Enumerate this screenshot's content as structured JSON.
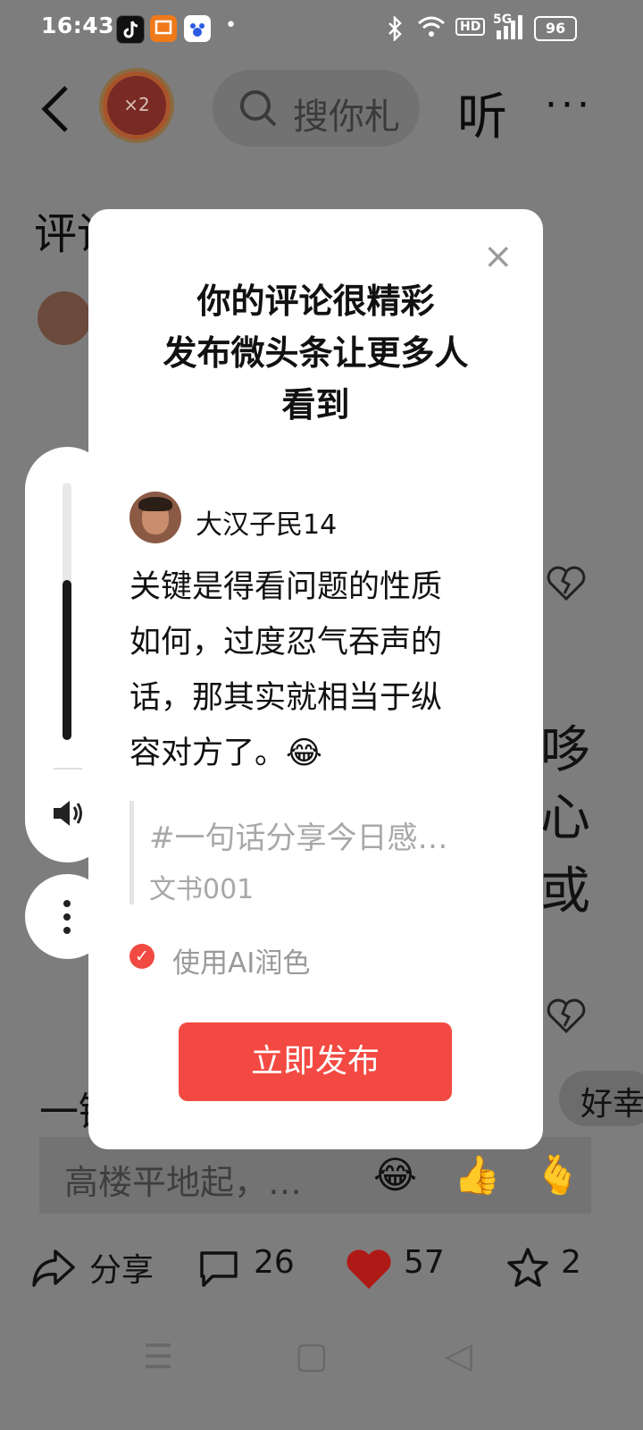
{
  "status_bar": {
    "time": "16:43",
    "dot": "•",
    "network": "5G",
    "battery": "96"
  },
  "header": {
    "coin_label": "×2",
    "search_placeholder": "搜你札",
    "listen_label": "听",
    "more_label": "···"
  },
  "background": {
    "title": "评论 26",
    "right_char_1": "哆",
    "right_char_2": "心",
    "right_char_3": "或",
    "left_text": "一键",
    "chip_label": "好幸",
    "input_placeholder": "高楼平地起，…",
    "emoji_1": "😂",
    "emoji_2": "👍",
    "emoji_3": "🫰"
  },
  "bottom_bar": {
    "share_label": "分享",
    "comment_count": "26",
    "like_count": "57",
    "star_count": "2"
  },
  "nav_bar": {
    "menu_glyph": "☰",
    "home_glyph": "▢",
    "back_glyph": "◁"
  },
  "modal": {
    "close_glyph": "×",
    "headline_line1": "你的评论很精彩",
    "headline_line2": "发布微头条让更多人",
    "headline_line3": "看到",
    "username": "大汉子民14",
    "comment_line1": "关键是得看问题的性质",
    "comment_line2": "如何，过度忍气吞声的",
    "comment_line3": "话，那其实就相当于纵",
    "comment_line4": "容对方了。😂",
    "topic": "#一句话分享今日感…",
    "author": "文书001",
    "ai_checked": true,
    "ai_label": "使用AI润色",
    "publish_label": "立即发布"
  },
  "colors": {
    "accent": "#f24a42",
    "overlay": "#7d7d7d"
  },
  "volume": {
    "level": 0.62
  }
}
